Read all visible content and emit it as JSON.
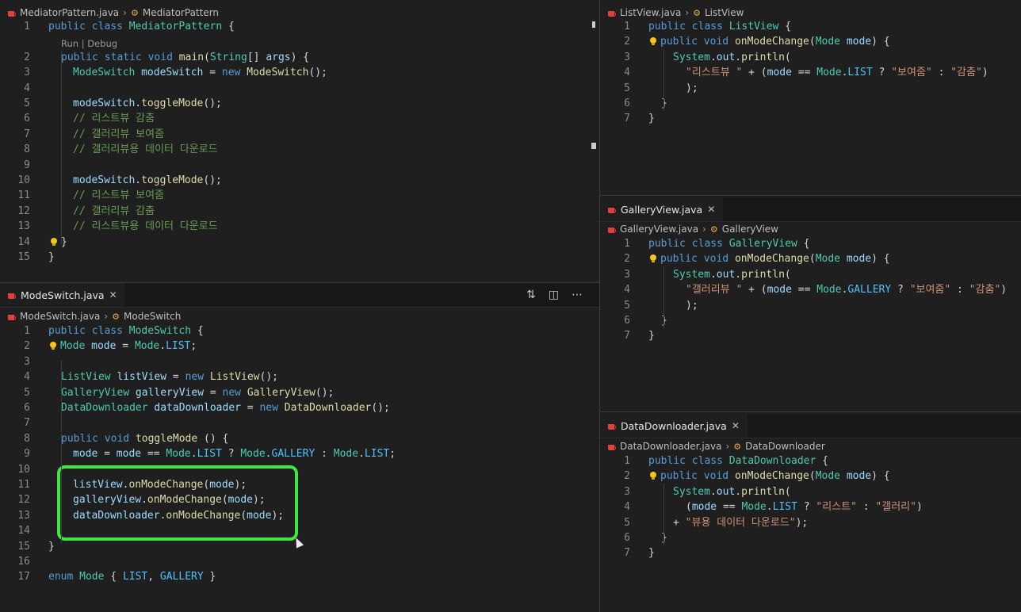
{
  "panes": {
    "mediator": {
      "crumb_file": "MediatorPattern.java",
      "crumb_class": "MediatorPattern",
      "codelens": "Run | Debug",
      "lines": [
        "1",
        "2",
        "3",
        "4",
        "5",
        "6",
        "7",
        "8",
        "9",
        "10",
        "11",
        "12",
        "13",
        "14",
        "15"
      ]
    },
    "modeswitch": {
      "tab_label": "ModeSwitch.java",
      "crumb_file": "ModeSwitch.java",
      "crumb_class": "ModeSwitch",
      "lines": [
        "1",
        "2",
        "3",
        "4",
        "5",
        "6",
        "7",
        "8",
        "9",
        "10",
        "11",
        "12",
        "13",
        "14",
        "15",
        "16",
        "17"
      ]
    },
    "listview": {
      "crumb_file": "ListView.java",
      "crumb_class": "ListView",
      "lines": [
        "1",
        "2",
        "3",
        "4",
        "5",
        "6",
        "7"
      ]
    },
    "galleryview": {
      "tab_label": "GalleryView.java",
      "crumb_file": "GalleryView.java",
      "crumb_class": "GalleryView",
      "lines": [
        "1",
        "2",
        "3",
        "4",
        "5",
        "6",
        "7"
      ]
    },
    "datadownloader": {
      "tab_label": "DataDownloader.java",
      "crumb_file": "DataDownloader.java",
      "crumb_class": "DataDownloader",
      "lines": [
        "1",
        "2",
        "3",
        "4",
        "5",
        "6",
        "7"
      ]
    }
  },
  "code": {
    "m1": [
      "public",
      " ",
      "class",
      " ",
      "MediatorPattern",
      " {"
    ],
    "m2": [
      "public",
      " ",
      "static",
      " ",
      "void",
      " ",
      "main",
      "(",
      "String",
      "[] ",
      "args",
      ") {"
    ],
    "m3": [
      "ModeSwitch",
      " ",
      "modeSwitch",
      " = ",
      "new",
      " ",
      "ModeSwitch",
      "();"
    ],
    "m5": [
      "modeSwitch",
      ".",
      "toggleMode",
      "();"
    ],
    "m6": "// 리스트뷰 감춤",
    "m7": "// 갤러리뷰 보여줌",
    "m8": "// 갤러리뷰용 데이터 다운로드",
    "m10": [
      "modeSwitch",
      ".",
      "toggleMode",
      "();"
    ],
    "m11": "// 리스트뷰 보여줌",
    "m12": "// 갤러리뷰 감춤",
    "m13": "// 리스트뷰용 데이터 다운로드",
    "m14": "}",
    "m15": "}",
    "s1": [
      "public",
      " ",
      "class",
      " ",
      "ModeSwitch",
      " {"
    ],
    "s2": [
      "Mode",
      " ",
      "mode",
      " = ",
      "Mode",
      ".",
      "LIST",
      ";"
    ],
    "s4": [
      "ListView",
      " ",
      "listView",
      " = ",
      "new",
      " ",
      "ListView",
      "();"
    ],
    "s5": [
      "GalleryView",
      " ",
      "galleryView",
      " = ",
      "new",
      " ",
      "GalleryView",
      "();"
    ],
    "s6": [
      "DataDownloader",
      " ",
      "dataDownloader",
      " = ",
      "new",
      " ",
      "DataDownloader",
      "();"
    ],
    "s8": [
      "public",
      " ",
      "void",
      " ",
      "toggleMode",
      " () {"
    ],
    "s9": [
      "mode",
      " = ",
      "mode",
      " == ",
      "Mode",
      ".",
      "LIST",
      " ? ",
      "Mode",
      ".",
      "GALLERY",
      " : ",
      "Mode",
      ".",
      "LIST",
      ";"
    ],
    "s11": [
      "listView",
      ".",
      "onModeChange",
      "(",
      "mode",
      ");"
    ],
    "s12": [
      "galleryView",
      ".",
      "onModeChange",
      "(",
      "mode",
      ");"
    ],
    "s13": [
      "dataDownloader",
      ".",
      "onModeChange",
      "(",
      "mode",
      ");"
    ],
    "s15": "}",
    "s17": [
      "enum",
      " ",
      "Mode",
      " { ",
      "LIST",
      ", ",
      "GALLERY",
      " }"
    ],
    "l1": [
      "public",
      " ",
      "class",
      " ",
      "ListView",
      " {"
    ],
    "l2": [
      "public",
      " ",
      "void",
      " ",
      "onModeChange",
      "(",
      "Mode",
      " ",
      "mode",
      ") {"
    ],
    "l3": [
      "System",
      ".",
      "out",
      ".",
      "println",
      "("
    ],
    "l4": [
      "\"리스트뷰 \"",
      " + (",
      "mode",
      " == ",
      "Mode",
      ".",
      "LIST",
      " ? ",
      "\"보여줌\"",
      " : ",
      "\"감춤\"",
      ")"
    ],
    "l5": ");",
    "l6": "}",
    "l7": "}",
    "g1": [
      "public",
      " ",
      "class",
      " ",
      "GalleryView",
      " {"
    ],
    "g2": [
      "public",
      " ",
      "void",
      " ",
      "onModeChange",
      "(",
      "Mode",
      " ",
      "mode",
      ") {"
    ],
    "g3": [
      "System",
      ".",
      "out",
      ".",
      "println",
      "("
    ],
    "g4": [
      "\"갤러리뷰 \"",
      " + (",
      "mode",
      " == ",
      "Mode",
      ".",
      "GALLERY",
      " ? ",
      "\"보여줌\"",
      " : ",
      "\"감춤\"",
      ")"
    ],
    "g5": ");",
    "g6": "}",
    "g7": "}",
    "d1": [
      "public",
      " ",
      "class",
      " ",
      "DataDownloader",
      " {"
    ],
    "d2": [
      "public",
      " ",
      "void",
      " ",
      "onModeChange",
      "(",
      "Mode",
      " ",
      "mode",
      ") {"
    ],
    "d3": [
      "System",
      ".",
      "out",
      ".",
      "println",
      "("
    ],
    "d4": [
      "(",
      "mode",
      " == ",
      "Mode",
      ".",
      "LIST",
      " ? ",
      "\"리스트\"",
      " : ",
      "\"갤러리\"",
      ")"
    ],
    "d5": [
      "+ ",
      "\"뷰용 데이터 다운로드\"",
      ");"
    ],
    "d6": "}",
    "d7": "}"
  },
  "colors": {
    "keyword": "#569cd6",
    "type": "#4ec9b0",
    "function": "#dcdcaa",
    "variable": "#9cdcfe",
    "string": "#ce9178",
    "comment": "#6a9955",
    "enum": "#4fc1ff",
    "highlight": "#3ee83e"
  },
  "icons": {
    "java": "java-file-icon",
    "class": "symbol-class-icon",
    "bulb": "lightbulb-icon",
    "split": "split-editor-icon",
    "compare": "compare-changes-icon",
    "more": "more-actions-icon",
    "close": "close-icon"
  }
}
